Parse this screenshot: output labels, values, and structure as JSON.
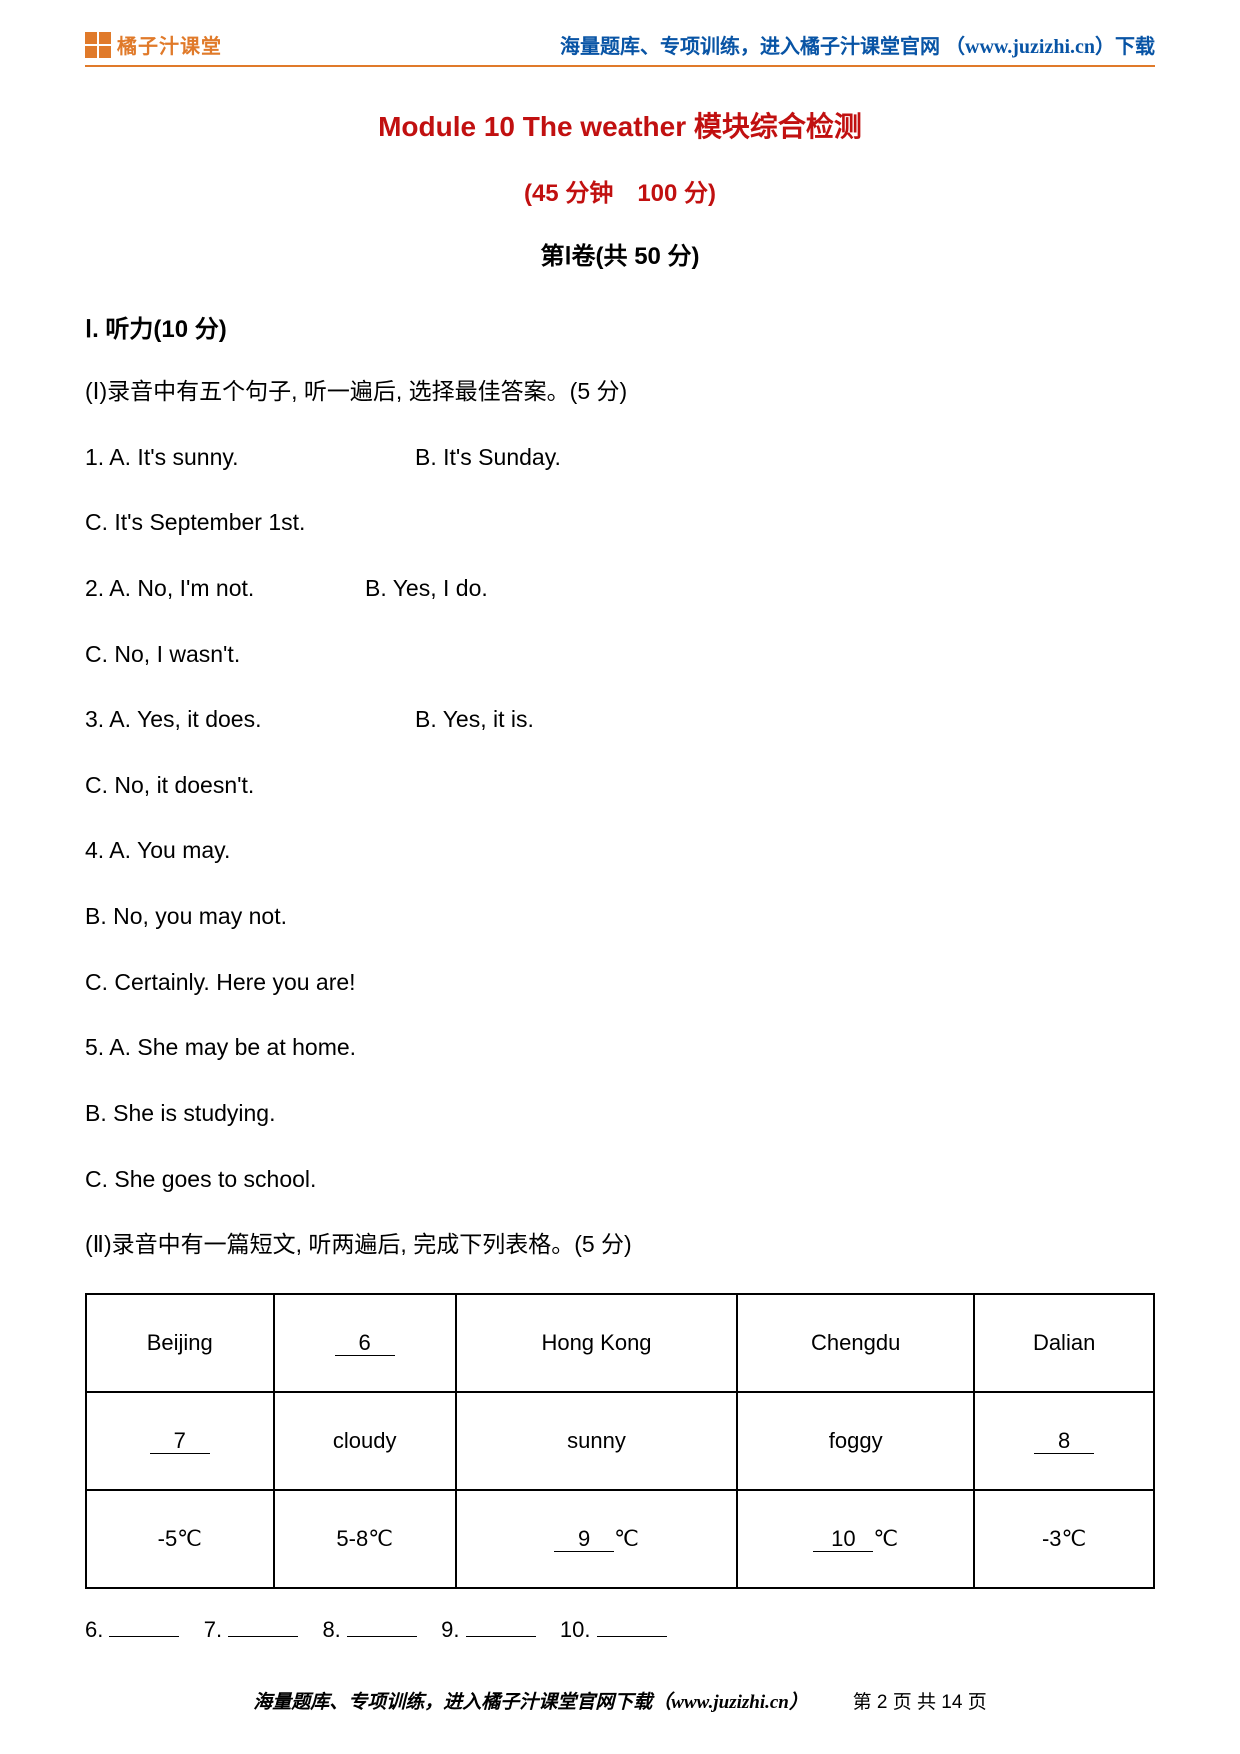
{
  "header": {
    "logo_text": "橘子汁课堂",
    "note": "海量题库、专项训练，进入橘子汁课堂官网 （www.juzizhi.cn）下载"
  },
  "titles": {
    "main": "Module 10 The weather 模块综合检测",
    "duration": "(45 分钟　100 分)",
    "paper": "第Ⅰ卷(共 50 分)"
  },
  "section1": {
    "head": "Ⅰ. 听力(10 分)",
    "intro1": "(Ⅰ)录音中有五个句子, 听一遍后, 选择最佳答案。(5 分)",
    "q1": {
      "a": "1. A. It's sunny.",
      "b": "B. It's Sunday."
    },
    "q1c": "C. It's September 1st.",
    "q2": {
      "a": "2. A. No, I'm not.",
      "b": "B. Yes, I do."
    },
    "q2c": "C. No, I wasn't.",
    "q3": {
      "a": "3. A. Yes, it does.",
      "b": "B. Yes, it is."
    },
    "q3c": "C. No, it doesn't.",
    "q4a": "4. A. You may.",
    "q4b": "B. No, you may not.",
    "q4c": "C. Certainly. Here you are!",
    "q5a": "5. A. She may be at home.",
    "q5b": "B. She is studying.",
    "q5c": "C. She goes to school.",
    "intro2": "(Ⅱ)录音中有一篇短文, 听两遍后, 完成下列表格。(5 分)"
  },
  "table": {
    "r1": {
      "c1": "Beijing",
      "c2": "6",
      "c3": "Hong Kong",
      "c4": "Chengdu",
      "c5": "Dalian"
    },
    "r2": {
      "c1": "7",
      "c2": "cloudy",
      "c3": "sunny",
      "c4": "foggy",
      "c5": "8"
    },
    "r3": {
      "c1": "-5℃",
      "c2": "5-8℃",
      "c3_blank": "9",
      "c3_tail": "℃",
      "c4_blank": "10",
      "c4_tail": "℃",
      "c5": "-3℃"
    }
  },
  "answers_row": {
    "p6": "6. ",
    "p7": "7. ",
    "p8": "8. ",
    "p9": "9. ",
    "p10": "10. "
  },
  "footer": {
    "note": "海量题库、专项训练，进入橘子汁课堂官网下载（www.juzizhi.cn）",
    "page": "第 2 页 共 14 页"
  }
}
